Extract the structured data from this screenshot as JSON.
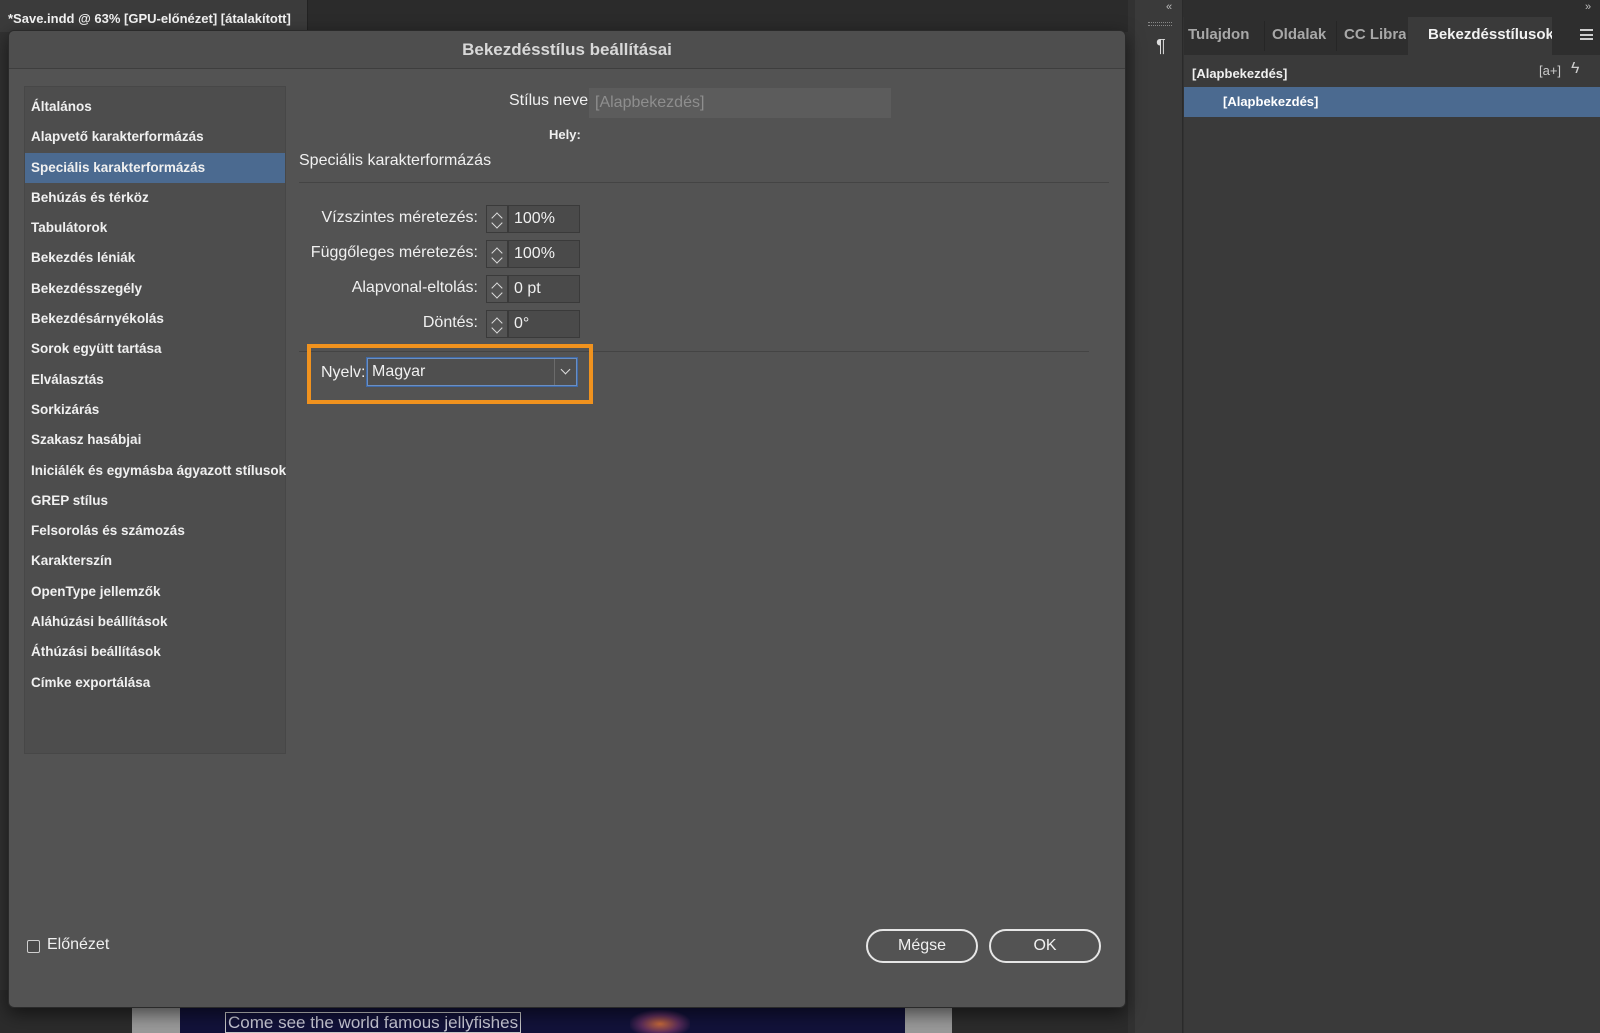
{
  "document_tab": {
    "title": "*Save.indd @ 63% [GPU-előnézet] [átalakított]"
  },
  "canvas": {
    "text": "Come see the world famous jellyfishes"
  },
  "dialog": {
    "title": "Bekezdésstílus beállításai",
    "categories": [
      "Általános",
      "Alapvető karakterformázás",
      "Speciális karakterformázás",
      "Behúzás és térköz",
      "Tabulátorok",
      "Bekezdés léniák",
      "Bekezdésszegély",
      "Bekezdésárnyékolás",
      "Sorok együtt tartása",
      "Elválasztás",
      "Sorkizárás",
      "Szakasz hasábjai",
      "Iniciálék és egymásba ágyazott stílusok",
      "GREP stílus",
      "Felsorolás és számozás",
      "Karakterszín",
      "OpenType jellemzők",
      "Aláhúzási beállítások",
      "Áthúzási beállítások",
      "Címke exportálása"
    ],
    "selected_category": "Speciális karakterformázás",
    "style_name_label": "Stílus neve:",
    "style_name_value": "[Alapbekezdés]",
    "location_label": "Hely:",
    "section_title": "Speciális karakterformázás",
    "fields": {
      "horizontal_scale": {
        "label": "Vízszintes méretezés:",
        "value": "100%"
      },
      "vertical_scale": {
        "label": "Függőleges méretezés:",
        "value": "100%"
      },
      "baseline_shift": {
        "label": "Alapvonal-eltolás:",
        "value": "0 pt"
      },
      "skew": {
        "label": "Döntés:",
        "value": "0°"
      }
    },
    "language": {
      "label": "Nyelv:",
      "value": "Magyar"
    },
    "preview_label": "Előnézet",
    "preview_checked": false,
    "cancel_label": "Mégse",
    "ok_label": "OK",
    "highlight_color": "#f0921e",
    "selection_color": "#4b6a90"
  },
  "right_panel": {
    "tabs": [
      "Tulajdon",
      "Oldalak",
      "CC Librar",
      "Bekezdésstílusok"
    ],
    "active_tab": "Bekezdésstílusok",
    "current_style": "[Alapbekezdés]",
    "new_style_icon_label": "[a+]",
    "styles": [
      "[Alapbekezdés]"
    ]
  }
}
